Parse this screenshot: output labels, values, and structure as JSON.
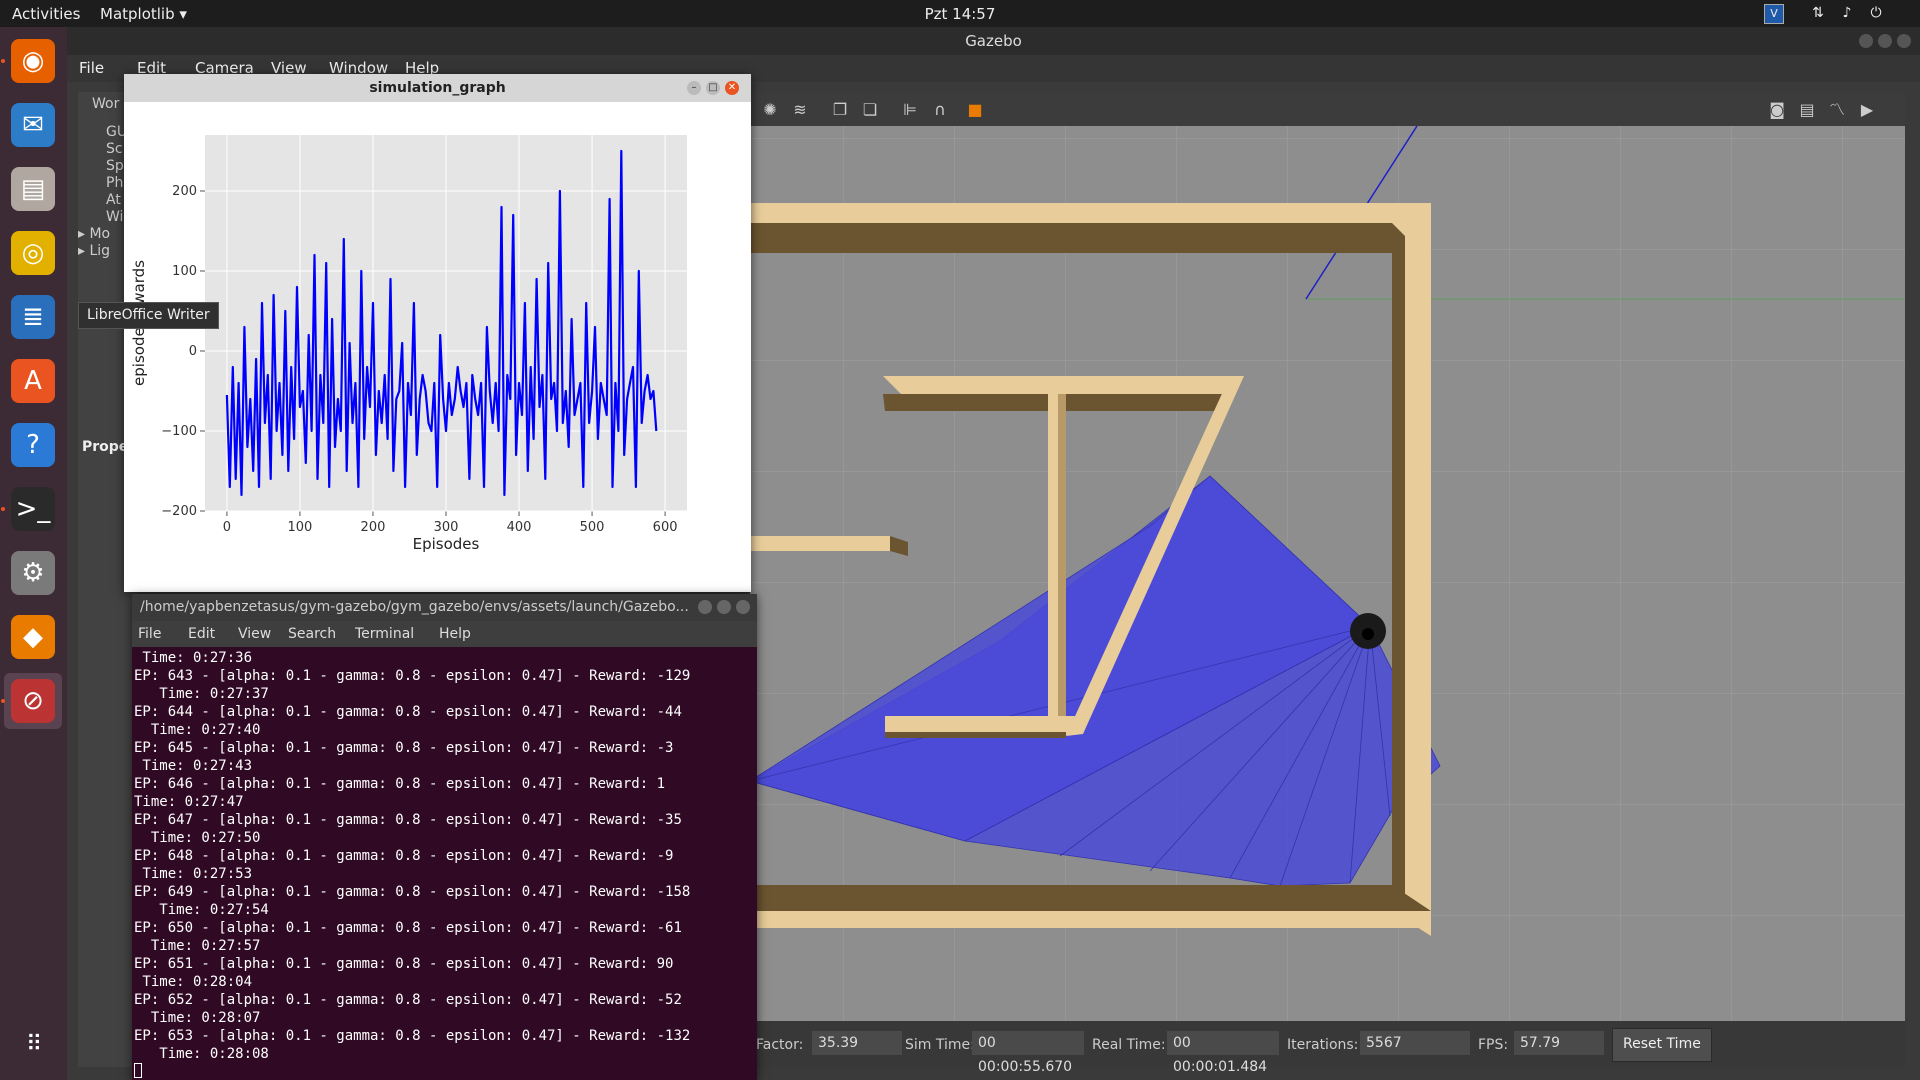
{
  "topbar": {
    "activities": "Activities",
    "app_menu": "Matplotlib ▾",
    "clock": "Pzt 14:57",
    "tray_icons": [
      "vscode-icon",
      "network-icon",
      "volume-icon",
      "power-icon"
    ]
  },
  "dock": {
    "items": [
      {
        "name": "firefox",
        "icon": "firefox-icon",
        "color": "#e66000"
      },
      {
        "name": "thunderbird",
        "icon": "mail-icon",
        "color": "#2d7cc8"
      },
      {
        "name": "files",
        "icon": "files-icon",
        "color": "#b0a8a0"
      },
      {
        "name": "rhythmbox",
        "icon": "music-icon",
        "color": "#e2b100"
      },
      {
        "name": "libreoffice-writer",
        "icon": "writer-icon",
        "color": "#2a6fbb"
      },
      {
        "name": "software",
        "icon": "software-center-icon",
        "color": "#e95420"
      },
      {
        "name": "help",
        "icon": "help-icon",
        "color": "#2b7bd6"
      },
      {
        "name": "terminal",
        "icon": "terminal-icon",
        "color": "#2a2a2a"
      },
      {
        "name": "settings",
        "icon": "settings-icon",
        "color": "#7a7a7a"
      },
      {
        "name": "gazebo-sim",
        "icon": "sim-icon",
        "color": "#e87b00"
      },
      {
        "name": "gazebo",
        "icon": "gazebo-icon",
        "color": "#b33"
      }
    ],
    "show_apps": "show-applications-icon"
  },
  "tooltip": "LibreOffice Writer",
  "gazebo": {
    "title": "Gazebo",
    "menu": [
      "File",
      "Edit",
      "Camera",
      "View",
      "Window",
      "Help"
    ],
    "left_panel_header": "Wor",
    "left_panel_items": [
      "GU",
      "Sc",
      "Sp",
      "Ph",
      "At",
      "Wi",
      "Mo",
      "Lig"
    ],
    "properties_label": "Prope",
    "status": {
      "factor_label": "Factor:",
      "factor_value": "35.39",
      "sim_time_label": "Sim Time:",
      "sim_time_value": "00 00:00:55.670",
      "real_time_label": "Real Time:",
      "real_time_value": "00 00:00:01.484",
      "iterations_label": "Iterations:",
      "iterations_value": "5567",
      "fps_label": "FPS:",
      "fps_value": "57.79",
      "reset_button": "Reset Time"
    }
  },
  "graph_window": {
    "title": "simulation_graph"
  },
  "chart_data": {
    "type": "line",
    "xlabel": "Episodes",
    "ylabel": "episode_rewards",
    "xlim": [
      -30,
      630
    ],
    "ylim": [
      -200,
      270
    ],
    "xticks": [
      0,
      100,
      200,
      300,
      400,
      500,
      600
    ],
    "yticks": [
      -200,
      -100,
      0,
      100,
      200
    ],
    "ytick_labels": [
      "−200",
      "−100",
      "0",
      "100",
      "200"
    ],
    "grid": true,
    "color": "#0000ff",
    "series": [
      {
        "x_start": 0,
        "x_step": 4,
        "values": [
          -55,
          -170,
          -20,
          -160,
          -40,
          -180,
          30,
          -120,
          -60,
          -150,
          -10,
          -170,
          60,
          -90,
          -30,
          -160,
          70,
          -100,
          -40,
          -130,
          50,
          -150,
          -20,
          -110,
          80,
          -70,
          -50,
          -140,
          20,
          -100,
          120,
          -160,
          -30,
          -90,
          110,
          -170,
          40,
          -120,
          -60,
          -100,
          140,
          -150,
          10,
          -90,
          -40,
          -170,
          100,
          -110,
          -20,
          -70,
          60,
          -130,
          -50,
          -90,
          -30,
          -110,
          90,
          -150,
          -60,
          -50,
          10,
          -170,
          -40,
          -80,
          60,
          -130,
          -60,
          -30,
          -50,
          -90,
          -100,
          -40,
          -170,
          20,
          -60,
          -100,
          -40,
          -80,
          -60,
          -20,
          -50,
          -70,
          -40,
          -160,
          -30,
          -60,
          -80,
          -40,
          -170,
          30,
          -50,
          -90,
          -40,
          -100,
          180,
          -180,
          -30,
          -60,
          170,
          -130,
          -40,
          -80,
          60,
          -150,
          -20,
          -110,
          90,
          -70,
          -30,
          -160,
          110,
          -60,
          -40,
          -100,
          200,
          -90,
          -50,
          -120,
          40,
          -80,
          -60,
          -40,
          -170,
          60,
          -90,
          -50,
          30,
          -110,
          -40,
          -60,
          -80,
          190,
          -170,
          -40,
          -100,
          250,
          -130,
          -60,
          -40,
          -20,
          -170,
          100,
          -90,
          -50,
          -30,
          -60,
          -50,
          -100
        ]
      }
    ]
  },
  "terminal": {
    "title": "/home/yapbenzetasus/gym-gazebo/gym_gazebo/envs/assets/launch/Gazebo...",
    "menu": [
      "File",
      "Edit",
      "View",
      "Search",
      "Terminal",
      "Help"
    ],
    "lines": [
      " Time: 0:27:36",
      "EP: 643 - [alpha: 0.1 - gamma: 0.8 - epsilon: 0.47] - Reward: -129",
      "   Time: 0:27:37",
      "EP: 644 - [alpha: 0.1 - gamma: 0.8 - epsilon: 0.47] - Reward: -44",
      "  Time: 0:27:40",
      "EP: 645 - [alpha: 0.1 - gamma: 0.8 - epsilon: 0.47] - Reward: -3",
      " Time: 0:27:43",
      "EP: 646 - [alpha: 0.1 - gamma: 0.8 - epsilon: 0.47] - Reward: 1",
      "Time: 0:27:47",
      "EP: 647 - [alpha: 0.1 - gamma: 0.8 - epsilon: 0.47] - Reward: -35",
      "  Time: 0:27:50",
      "EP: 648 - [alpha: 0.1 - gamma: 0.8 - epsilon: 0.47] - Reward: -9",
      " Time: 0:27:53",
      "EP: 649 - [alpha: 0.1 - gamma: 0.8 - epsilon: 0.47] - Reward: -158",
      "   Time: 0:27:54",
      "EP: 650 - [alpha: 0.1 - gamma: 0.8 - epsilon: 0.47] - Reward: -61",
      "  Time: 0:27:57",
      "EP: 651 - [alpha: 0.1 - gamma: 0.8 - epsilon: 0.47] - Reward: 90",
      " Time: 0:28:04",
      "EP: 652 - [alpha: 0.1 - gamma: 0.8 - epsilon: 0.47] - Reward: -52",
      "  Time: 0:28:07",
      "EP: 653 - [alpha: 0.1 - gamma: 0.8 - epsilon: 0.47] - Reward: -132",
      "   Time: 0:28:08"
    ]
  }
}
